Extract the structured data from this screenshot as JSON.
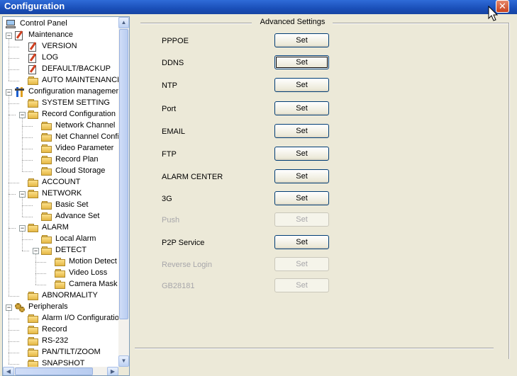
{
  "window": {
    "title": "Configuration",
    "close_glyph": "✕"
  },
  "tree": {
    "items": [
      {
        "label": "Control Panel",
        "icon": "pc-icon",
        "depth": 0,
        "expander": ""
      },
      {
        "label": "Maintenance",
        "icon": "doc-icon",
        "depth": 0,
        "expander": "−"
      },
      {
        "label": "VERSION",
        "icon": "doc-icon",
        "depth": 1,
        "expander": ""
      },
      {
        "label": "LOG",
        "icon": "doc-icon",
        "depth": 1,
        "expander": ""
      },
      {
        "label": "DEFAULT/BACKUP",
        "icon": "doc-icon",
        "depth": 1,
        "expander": ""
      },
      {
        "label": "AUTO MAINTENANCE",
        "icon": "folder-icon",
        "depth": 1,
        "expander": ""
      },
      {
        "label": "Configuration management",
        "icon": "tools-icon",
        "depth": 0,
        "expander": "−"
      },
      {
        "label": "SYSTEM SETTING",
        "icon": "folder-icon",
        "depth": 1,
        "expander": ""
      },
      {
        "label": "Record Configuration",
        "icon": "folder-icon",
        "depth": 1,
        "expander": "−"
      },
      {
        "label": "Network Channel",
        "icon": "folder-icon",
        "depth": 2,
        "expander": ""
      },
      {
        "label": "Net Channel Config",
        "icon": "folder-icon",
        "depth": 2,
        "expander": ""
      },
      {
        "label": "Video Parameter",
        "icon": "folder-icon",
        "depth": 2,
        "expander": ""
      },
      {
        "label": "Record Plan",
        "icon": "folder-icon",
        "depth": 2,
        "expander": ""
      },
      {
        "label": "Cloud Storage",
        "icon": "folder-icon",
        "depth": 2,
        "expander": ""
      },
      {
        "label": "ACCOUNT",
        "icon": "folder-icon",
        "depth": 1,
        "expander": ""
      },
      {
        "label": "NETWORK",
        "icon": "folder-icon",
        "depth": 1,
        "expander": "−"
      },
      {
        "label": "Basic Set",
        "icon": "folder-icon",
        "depth": 2,
        "expander": ""
      },
      {
        "label": "Advance Set",
        "icon": "folder-icon",
        "depth": 2,
        "expander": ""
      },
      {
        "label": "ALARM",
        "icon": "folder-icon",
        "depth": 1,
        "expander": "−"
      },
      {
        "label": "Local Alarm",
        "icon": "folder-icon",
        "depth": 2,
        "expander": ""
      },
      {
        "label": "DETECT",
        "icon": "folder-icon",
        "depth": 2,
        "expander": "−"
      },
      {
        "label": "Motion Detect",
        "icon": "folder-icon",
        "depth": 3,
        "expander": ""
      },
      {
        "label": "Video Loss",
        "icon": "folder-icon",
        "depth": 3,
        "expander": ""
      },
      {
        "label": "Camera Mask",
        "icon": "folder-icon",
        "depth": 3,
        "expander": ""
      },
      {
        "label": "ABNORMALITY",
        "icon": "folder-icon",
        "depth": 1,
        "expander": ""
      },
      {
        "label": "Peripherals",
        "icon": "gear-icon",
        "depth": 0,
        "expander": "−"
      },
      {
        "label": "Alarm I/O Configuration",
        "icon": "folder-icon",
        "depth": 1,
        "expander": ""
      },
      {
        "label": "Record",
        "icon": "folder-icon",
        "depth": 1,
        "expander": ""
      },
      {
        "label": "RS-232",
        "icon": "folder-icon",
        "depth": 1,
        "expander": ""
      },
      {
        "label": "PAN/TILT/ZOOM",
        "icon": "folder-icon",
        "depth": 1,
        "expander": ""
      },
      {
        "label": "SNAPSHOT",
        "icon": "folder-icon",
        "depth": 1,
        "expander": ""
      }
    ],
    "scroll_up": "▲",
    "scroll_down": "▼",
    "scroll_left": "◀",
    "scroll_right": "▶"
  },
  "advanced": {
    "group_title": "Advanced Settings",
    "rows": [
      {
        "label": "PPPOE",
        "button": "Set",
        "enabled": true,
        "focused": false
      },
      {
        "label": "DDNS",
        "button": "Set",
        "enabled": true,
        "focused": true
      },
      {
        "label": "NTP",
        "button": "Set",
        "enabled": true,
        "focused": false
      },
      {
        "label": "Port",
        "button": "Set",
        "enabled": true,
        "focused": false
      },
      {
        "label": "EMAIL",
        "button": "Set",
        "enabled": true,
        "focused": false
      },
      {
        "label": "FTP",
        "button": "Set",
        "enabled": true,
        "focused": false
      },
      {
        "label": "ALARM CENTER",
        "button": "Set",
        "enabled": true,
        "focused": false
      },
      {
        "label": "3G",
        "button": "Set",
        "enabled": true,
        "focused": false
      },
      {
        "label": "Push",
        "button": "Set",
        "enabled": false,
        "focused": false
      },
      {
        "label": "P2P Service",
        "button": "Set",
        "enabled": true,
        "focused": false
      },
      {
        "label": "Reverse Login",
        "button": "Set",
        "enabled": false,
        "focused": false
      },
      {
        "label": "GB28181",
        "button": "Set",
        "enabled": false,
        "focused": false
      }
    ]
  }
}
